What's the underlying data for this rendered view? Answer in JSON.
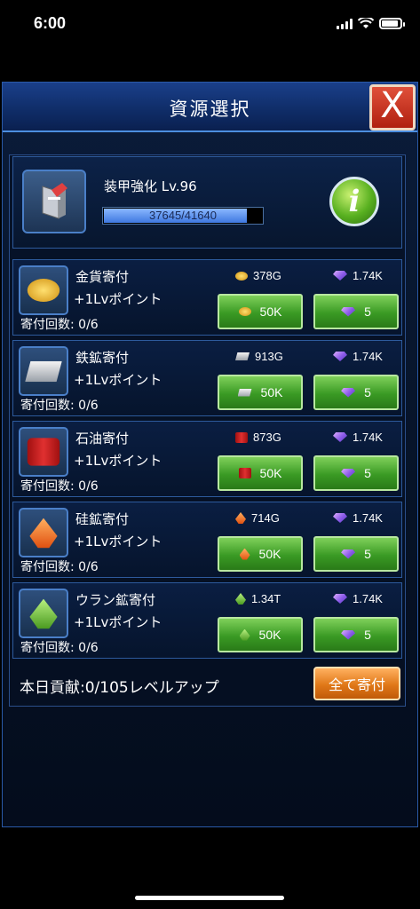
{
  "status_bar": {
    "time": "6:00"
  },
  "dialog": {
    "title": "資源選択",
    "close_label": "X"
  },
  "item": {
    "name": "装甲強化 Lv.96",
    "progress_text": "37645/41640",
    "progress_fraction": 0.904,
    "info_label": "i"
  },
  "resources": [
    {
      "name": "金貨寄付",
      "sub": "+1Lvポイント",
      "count": "寄付回数: 0/6",
      "icon": "gold-coin-icon",
      "cost": "378G",
      "gem_cost": "1.74K",
      "btn_amount": "50K",
      "btn_gem": "5"
    },
    {
      "name": "鉄鉱寄付",
      "sub": "+1Lvポイント",
      "count": "寄付回数: 0/6",
      "icon": "iron-ingot-icon",
      "cost": "913G",
      "gem_cost": "1.74K",
      "btn_amount": "50K",
      "btn_gem": "5"
    },
    {
      "name": "石油寄付",
      "sub": "+1Lvポイント",
      "count": "寄付回数: 0/6",
      "icon": "oil-barrel-icon",
      "cost": "873G",
      "gem_cost": "1.74K",
      "btn_amount": "50K",
      "btn_gem": "5"
    },
    {
      "name": "硅鉱寄付",
      "sub": "+1Lvポイント",
      "count": "寄付回数: 0/6",
      "icon": "silicon-crystal-icon",
      "cost": "714G",
      "gem_cost": "1.74K",
      "btn_amount": "50K",
      "btn_gem": "5"
    },
    {
      "name": "ウラン鉱寄付",
      "sub": "+1Lvポイント",
      "count": "寄付回数: 0/6",
      "icon": "uranium-crystal-icon",
      "cost": "1.34T",
      "gem_cost": "1.74K",
      "btn_amount": "50K",
      "btn_gem": "5"
    }
  ],
  "footer": {
    "contribution": "本日貢献:0/105レベルアップ",
    "donate_all": "全て寄付"
  },
  "colors": {
    "accent_green": "#3a9a24",
    "accent_orange": "#e07818",
    "close_red": "#b02010"
  }
}
